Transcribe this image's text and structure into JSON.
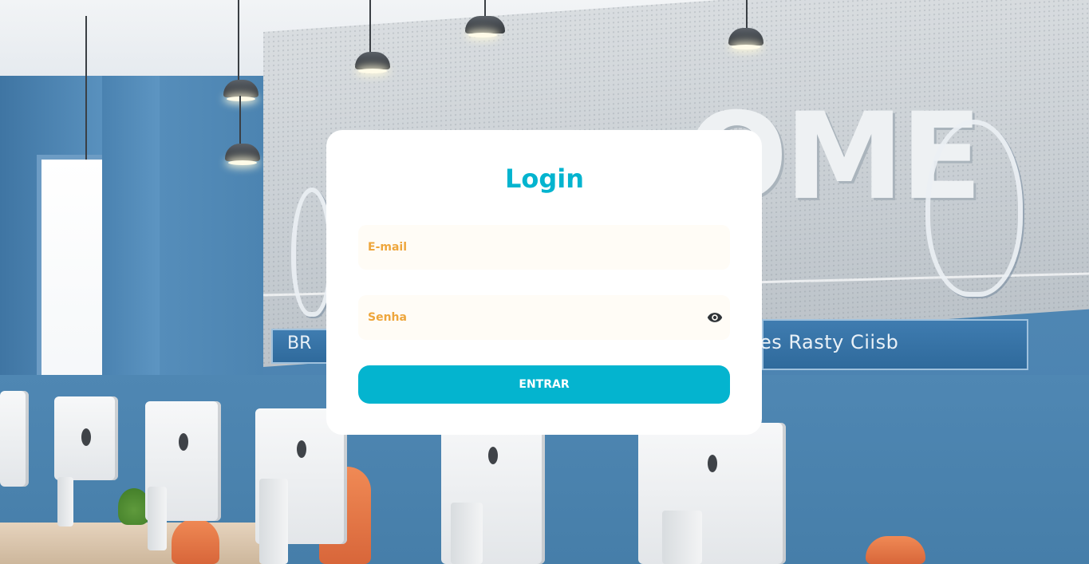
{
  "background": {
    "wall_sign_text": "es Rasty Ciisb",
    "wall_sign_left_text": "BR",
    "wall_big_letters": "OME"
  },
  "login": {
    "title": "Login",
    "email_placeholder": "E-mail",
    "password_placeholder": "Senha",
    "submit_label": "ENTRAR"
  },
  "colors": {
    "accent": "#04b4cf",
    "placeholder": "#eea63c",
    "field_bg": "#fffcf6"
  },
  "icons": {
    "password_toggle": "eye-icon"
  }
}
